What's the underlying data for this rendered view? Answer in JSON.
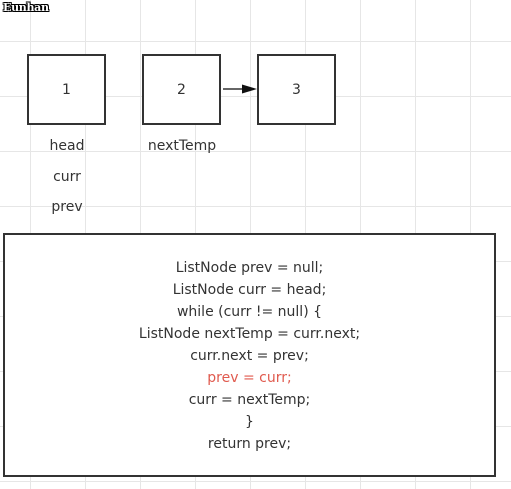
{
  "watermark": "Eunhan",
  "nodes": [
    "1",
    "2",
    "3"
  ],
  "labels": {
    "head": "head",
    "curr": "curr",
    "prev": "prev",
    "next_temp": "nextTemp"
  },
  "code": [
    "ListNode prev = null;",
    "ListNode curr = head;",
    "while (curr != null) {",
    "ListNode nextTemp = curr.next;",
    "curr.next = prev;",
    "prev = curr;",
    "curr = nextTemp;",
    "}",
    "return prev;"
  ],
  "highlighted_line": "prev = curr;",
  "colors": {
    "stroke": "#333333",
    "highlight": "#e05a4e",
    "grid": "#e6e6e6"
  }
}
